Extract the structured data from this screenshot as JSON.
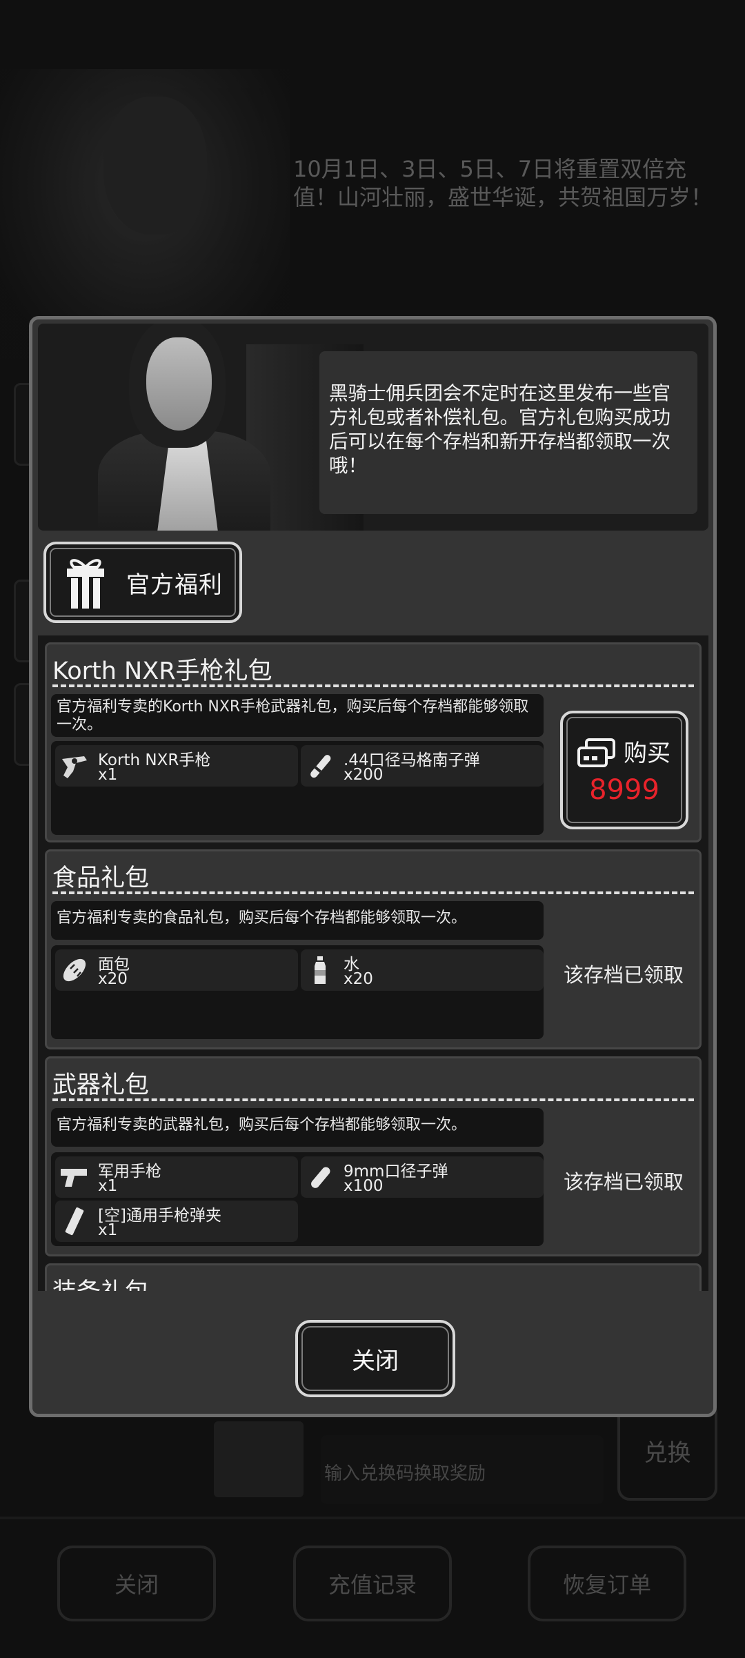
{
  "background": {
    "announcement": "10月1日、3日、5日、7日将重置双倍充值！山河壮丽，盛世华诞，共贺祖国万岁！",
    "redeem_placeholder": "输入兑换码换取奖励",
    "redeem_button": "兑换",
    "bottom_buttons": [
      "关闭",
      "充值记录",
      "恢复订单"
    ]
  },
  "dialog": {
    "npc_message": "黑骑士佣兵团会不定时在这里发布一些官方礼包或者补偿礼包。官方礼包购买成功后可以在每个存档和新开存档都领取一次哦！",
    "tab_label": "官方福利",
    "close_label": "关闭",
    "packages": [
      {
        "title": "Korth NXR手枪礼包",
        "description": "官方福利专卖的Korth NXR手枪武器礼包，购买后每个存档都能够领取一次。",
        "items": [
          {
            "name": "Korth NXR手枪",
            "qty": "x1",
            "icon": "revolver-icon"
          },
          {
            "name": ".44口径马格南子弹",
            "qty": "x200",
            "icon": "bullet-icon"
          }
        ],
        "action": {
          "type": "buy",
          "label": "购买",
          "price": "8999"
        }
      },
      {
        "title": "食品礼包",
        "description": "官方福利专卖的食品礼包，购买后每个存档都能够领取一次。",
        "items": [
          {
            "name": "面包",
            "qty": "x20",
            "icon": "bread-icon"
          },
          {
            "name": "水",
            "qty": "x20",
            "icon": "water-bottle-icon"
          }
        ],
        "action": {
          "type": "status",
          "label": "该存档已领取"
        }
      },
      {
        "title": "武器礼包",
        "description": "官方福利专卖的武器礼包，购买后每个存档都能够领取一次。",
        "items": [
          {
            "name": "军用手枪",
            "qty": "x1",
            "icon": "pistol-icon"
          },
          {
            "name": "9mm口径子弹",
            "qty": "x100",
            "icon": "bullet-icon"
          },
          {
            "name": "[空]通用手枪弹夹",
            "qty": "x1",
            "icon": "magazine-icon"
          }
        ],
        "action": {
          "type": "status",
          "label": "该存档已领取"
        }
      },
      {
        "title": "装备礼包"
      }
    ]
  },
  "colors": {
    "price": "#e8232b",
    "panel": "#343434",
    "dark": "#141414"
  }
}
